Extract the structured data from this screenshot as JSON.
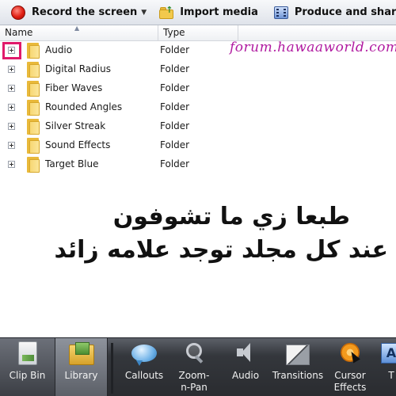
{
  "toolbar": {
    "record_label": "Record the screen",
    "import_label": "Import media",
    "produce_label": "Produce and share"
  },
  "columns": {
    "name": "Name",
    "type": "Type"
  },
  "rows": [
    {
      "name": "Audio",
      "type": "Folder"
    },
    {
      "name": "Digital Radius",
      "type": "Folder"
    },
    {
      "name": "Fiber Waves",
      "type": "Folder"
    },
    {
      "name": "Rounded Angles",
      "type": "Folder"
    },
    {
      "name": "Silver Streak",
      "type": "Folder"
    },
    {
      "name": "Sound Effects",
      "type": "Folder"
    },
    {
      "name": "Target Blue",
      "type": "Folder"
    }
  ],
  "watermark": "forum.hawaaworld.com",
  "caption": {
    "line1": "طبعا زي ما تشوفون",
    "line2": "عند كل مجلد توجد علامه زائد"
  },
  "tabs": {
    "clip_bin": "Clip Bin",
    "library": "Library",
    "callouts": "Callouts",
    "zoom_n_pan": "Zoom-n-Pan",
    "audio": "Audio",
    "transitions": "Transitions",
    "cursor_effects": "Cursor Effects",
    "more": "T"
  },
  "colors": {
    "highlight": "#e01a6b",
    "watermark": "#b01aa0",
    "folder": "#f2c94c"
  }
}
